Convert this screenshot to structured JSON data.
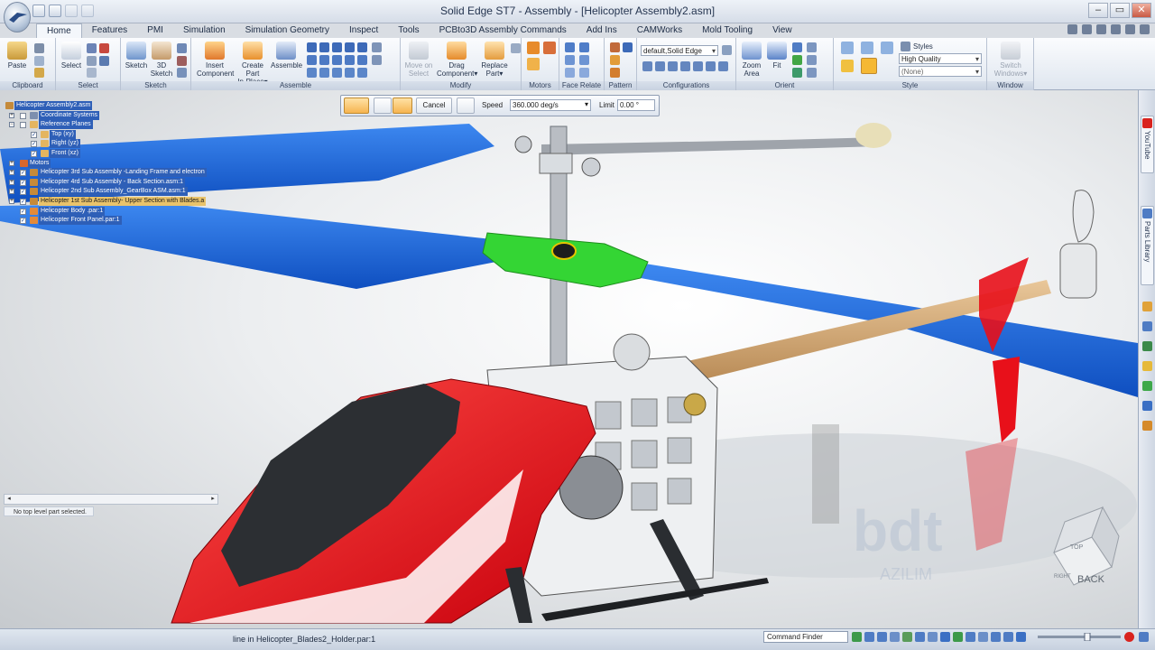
{
  "window": {
    "title": "Solid Edge ST7 - Assembly - [Helicopter Assembly2.asm]",
    "controls": [
      "–",
      "▭",
      "✕"
    ]
  },
  "tabs": [
    "Home",
    "Features",
    "PMI",
    "Simulation",
    "Simulation Geometry",
    "Inspect",
    "Tools",
    "PCBto3D Assembly Commands",
    "Add Ins",
    "CAMWorks",
    "Mold Tooling",
    "View"
  ],
  "active_tab": "Home",
  "ribbon": {
    "groups": [
      "Clipboard",
      "Select",
      "Sketch",
      "Assemble",
      "Modify",
      "Motors",
      "Face Relate",
      "Pattern",
      "Configurations",
      "Orient",
      "Style",
      "Window"
    ],
    "buttons": {
      "paste": "Paste",
      "select": "Select",
      "sketch": "Sketch",
      "sketch3d_1": "3D",
      "sketch3d_2": "Sketch",
      "insert_1": "Insert",
      "insert_2": "Component",
      "create_part_1": "Create Part",
      "create_part_2": "In-Place",
      "assemble": "Assemble",
      "move_1": "Move on",
      "move_2": "Select",
      "drag_1": "Drag",
      "drag_2": "Component",
      "replace_1": "Replace",
      "replace_2": "Part",
      "zoom_1": "Zoom",
      "zoom_2": "Area",
      "fit": "Fit",
      "switch_1": "Switch",
      "switch_2": "Windows"
    },
    "configuration_value": "default,Solid Edge",
    "styles_label": "Styles",
    "quality_value": "High Quality",
    "none_value": "(None)"
  },
  "command_bar": {
    "cancel_label": "Cancel",
    "speed_label": "Speed",
    "speed_value": "360.000 deg/s",
    "limit_label": "Limit",
    "limit_value": "0.00 °"
  },
  "tree": [
    {
      "label": "Helicopter Assembly2.asm",
      "level": 0,
      "style": "hl"
    },
    {
      "label": "Coordinate Systems",
      "level": 1,
      "style": "hl"
    },
    {
      "label": "Reference Planes",
      "level": 1,
      "style": "hl"
    },
    {
      "label": "Top (xy)",
      "level": 2,
      "style": "hl"
    },
    {
      "label": "Right (yz)",
      "level": 2,
      "style": "hl"
    },
    {
      "label": "Front (xz)",
      "level": 2,
      "style": "hl"
    },
    {
      "label": "Motors",
      "level": 1,
      "style": "hl"
    },
    {
      "label": "Helicopter 3rd Sub Assembly -Landing Frame and electron",
      "level": 1,
      "style": "hl"
    },
    {
      "label": "Helicopter 4rd Sub Assembly - Back Section.asm:1",
      "level": 1,
      "style": "hl"
    },
    {
      "label": "Helicopter 2nd Sub Assembly_GearBox ASM.asm:1",
      "level": 1,
      "style": "hl"
    },
    {
      "label": "Helicopter 1st Sub Assembly- Upper Section with Blades.a",
      "level": 1,
      "style": "hl2"
    },
    {
      "label": "Helicopter Body .par:1",
      "level": 1,
      "style": "hl"
    },
    {
      "label": "Helicopter Front Panel.par:1",
      "level": 1,
      "style": "hl"
    }
  ],
  "pane_status": "No top level part selected.",
  "right_dock": {
    "youtube_label": "YouTube",
    "parts_library_label": "Parts Library"
  },
  "viewport": {
    "view_cube_back": "BACK",
    "view_cube_top": "TOP",
    "view_cube_right": "RIGHT",
    "watermark_main": "bdt",
    "watermark_sub": "AZILIM"
  },
  "statusbar": {
    "message": "line in Helicopter_Blades2_Holder.par:1",
    "command_finder": "Command Finder"
  },
  "colors": {
    "blade_blue": "#1565d8",
    "canopy_red": "#e8101a",
    "hub_green": "#34d534",
    "ribbon_bg": "#eef2f8"
  }
}
